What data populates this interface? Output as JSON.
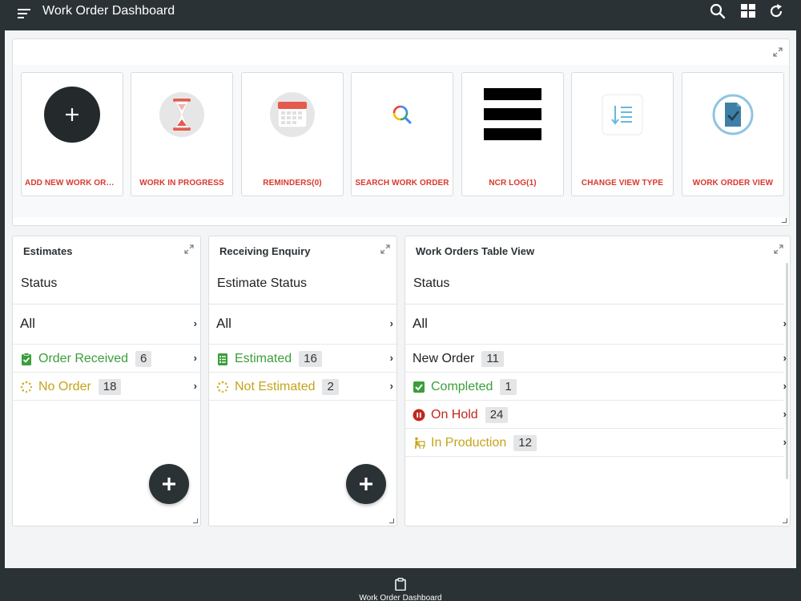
{
  "header": {
    "title": "Work Order Dashboard",
    "icons": [
      "menu-icon",
      "search-icon",
      "grid-icon",
      "refresh-icon"
    ]
  },
  "tiles": [
    {
      "label": "ADD NEW WORK ORDER",
      "icon": "add-icon"
    },
    {
      "label": "WORK IN PROGRESS",
      "icon": "hourglass-icon"
    },
    {
      "label": "REMINDERS(0)",
      "icon": "calendar-icon"
    },
    {
      "label": "SEARCH WORK ORDER",
      "icon": "search-icon"
    },
    {
      "label": "NCR LOG(1)",
      "icon": "bars-icon"
    },
    {
      "label": "CHANGE VIEW TYPE",
      "icon": "sort-list-icon"
    },
    {
      "label": "WORK ORDER VIEW",
      "icon": "document-check-icon"
    }
  ],
  "estimates": {
    "title": "Estimates",
    "section": "Status",
    "all_label": "All",
    "rows": [
      {
        "label": "Order Received",
        "count": "6",
        "color": "#3b9e3b",
        "icon": "clipboard-check-icon"
      },
      {
        "label": "No Order",
        "count": "18",
        "color": "#c4a41a",
        "icon": "spinner-icon"
      }
    ]
  },
  "receiving": {
    "title": "Receiving Enquiry",
    "section": "Estimate Status",
    "all_label": "All",
    "rows": [
      {
        "label": "Estimated",
        "count": "16",
        "color": "#3b9e3b",
        "icon": "checklist-icon"
      },
      {
        "label": "Not Estimated",
        "count": "2",
        "color": "#c4a41a",
        "icon": "spinner-icon"
      }
    ]
  },
  "work_orders": {
    "title": "Work Orders Table View",
    "section": "Status",
    "all_label": "All",
    "rows": [
      {
        "label": "New Order",
        "count": "11",
        "color": "#222222",
        "icon": ""
      },
      {
        "label": "Completed",
        "count": "1",
        "color": "#3b9e3b",
        "icon": "checkbox-icon"
      },
      {
        "label": "On Hold",
        "count": "24",
        "color": "#c0281d",
        "icon": "pause-circle-icon"
      },
      {
        "label": "In Production",
        "count": "12",
        "color": "#c4a41a",
        "icon": "worker-icon"
      }
    ]
  },
  "footer": {
    "label": "Work Order Dashboard",
    "icon": "clipboard-icon"
  }
}
